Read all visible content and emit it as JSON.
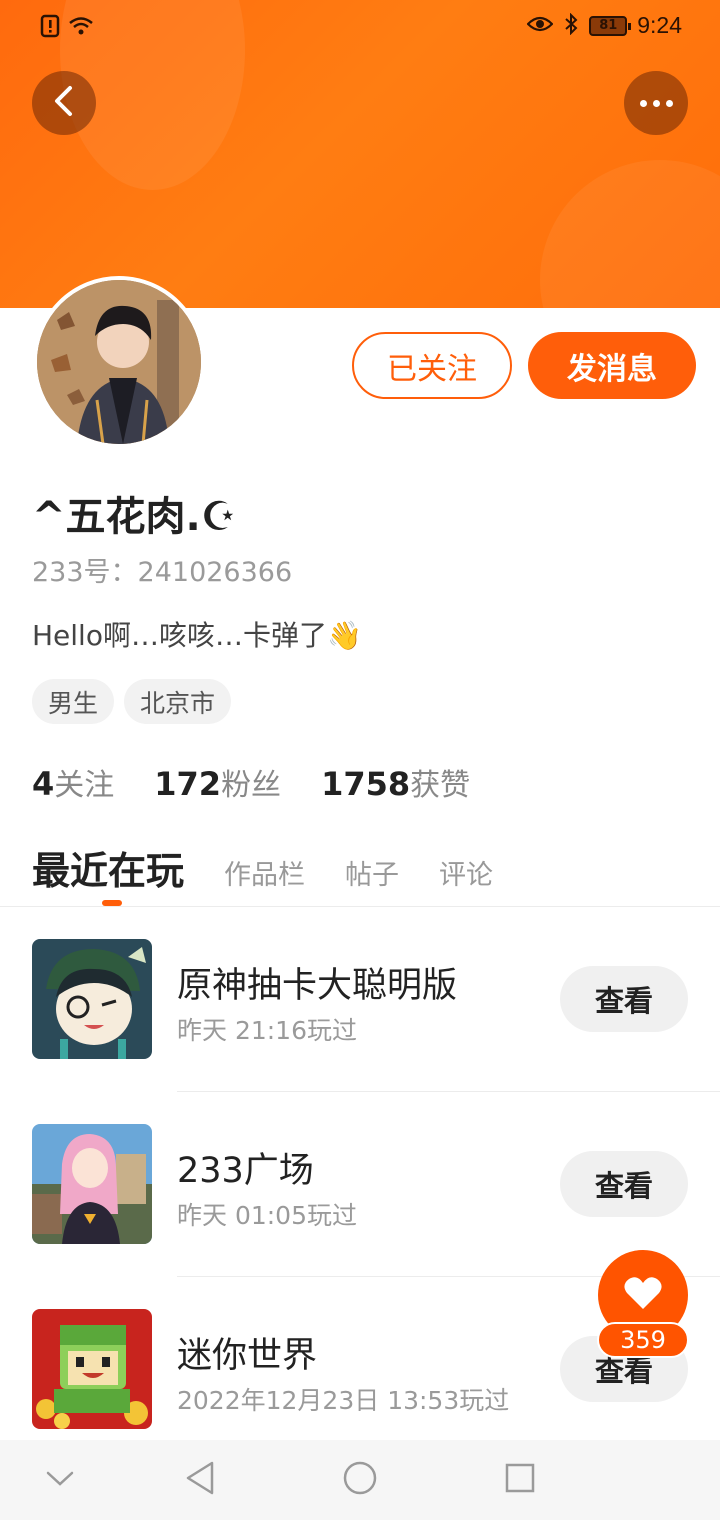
{
  "status_bar": {
    "time": "9:24",
    "battery": "81"
  },
  "profile": {
    "username": "^五花肉.☪",
    "uid_text": "233号：241026366",
    "bio": "Hello啊…咳咳…卡弹了👋",
    "tags": [
      "男生",
      "北京市"
    ],
    "followed_label": "已关注",
    "message_label": "发消息"
  },
  "stats": [
    {
      "value": "4",
      "label": "关注"
    },
    {
      "value": "172",
      "label": "粉丝"
    },
    {
      "value": "1758",
      "label": "获赞"
    }
  ],
  "tabs": [
    "最近在玩",
    "作品栏",
    "帖子",
    "评论"
  ],
  "games": [
    {
      "title": "原神抽卡大聪明版",
      "played": "昨天 21:16玩过",
      "action": "查看"
    },
    {
      "title": "233广场",
      "played": "昨天 01:05玩过",
      "action": "查看"
    },
    {
      "title": "迷你世界",
      "played": "2022年12月23日 13:53玩过",
      "action": "查看"
    }
  ],
  "like": {
    "count": "359"
  },
  "colors": {
    "accent": "#ff5e0a",
    "header": "#ff7410"
  },
  "icons": {
    "back": "chevron-left-icon",
    "more": "more-dots-icon",
    "heart": "heart-icon",
    "nav": [
      "nav-down-icon",
      "nav-back-icon",
      "nav-home-icon",
      "nav-recents-icon"
    ]
  }
}
